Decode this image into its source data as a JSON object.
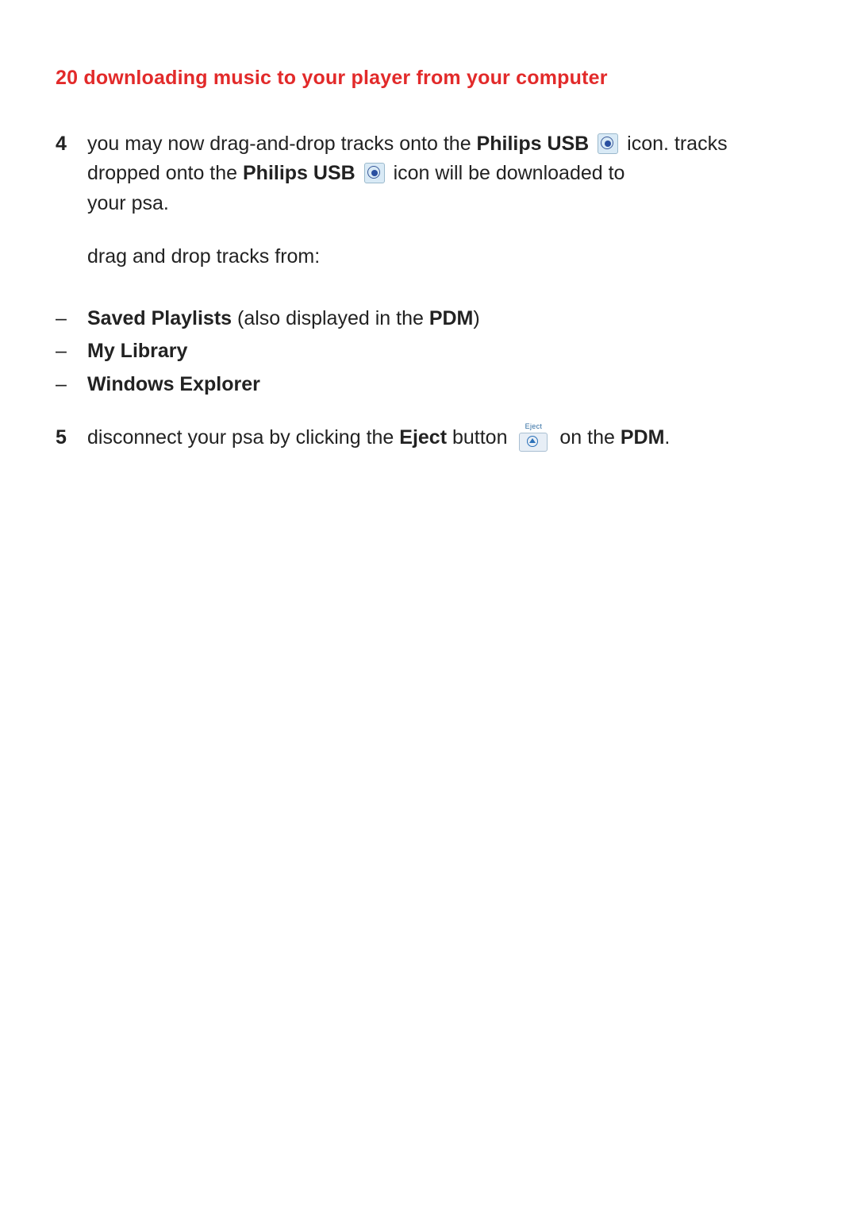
{
  "heading": "20 downloading music to your player from your computer",
  "step4": {
    "number": "4",
    "line1_a": "you may now drag-and-drop tracks onto the ",
    "line1_bold1": "Philips USB",
    "line1_b": " icon. tracks dropped onto the ",
    "line1_bold2": "Philips USB",
    "line1_c": " icon will be downloaded to",
    "line2": "your psa.",
    "para2": "drag and drop tracks from:"
  },
  "bullets": [
    {
      "bold": "Saved Playlists",
      "rest_a": " (also displayed in the ",
      "rest_bold": "PDM",
      "rest_c": ")"
    },
    {
      "bold": "My Library",
      "rest_a": "",
      "rest_bold": "",
      "rest_c": ""
    },
    {
      "bold": "Windows Explorer",
      "rest_a": "",
      "rest_bold": "",
      "rest_c": ""
    }
  ],
  "step5": {
    "number": "5",
    "a": "disconnect your psa by clicking the ",
    "bold_eject": "Eject",
    "b": " button ",
    "c": " on the ",
    "bold_pdm": "PDM",
    "d": "."
  },
  "eject_label": "Eject",
  "dash": "–"
}
